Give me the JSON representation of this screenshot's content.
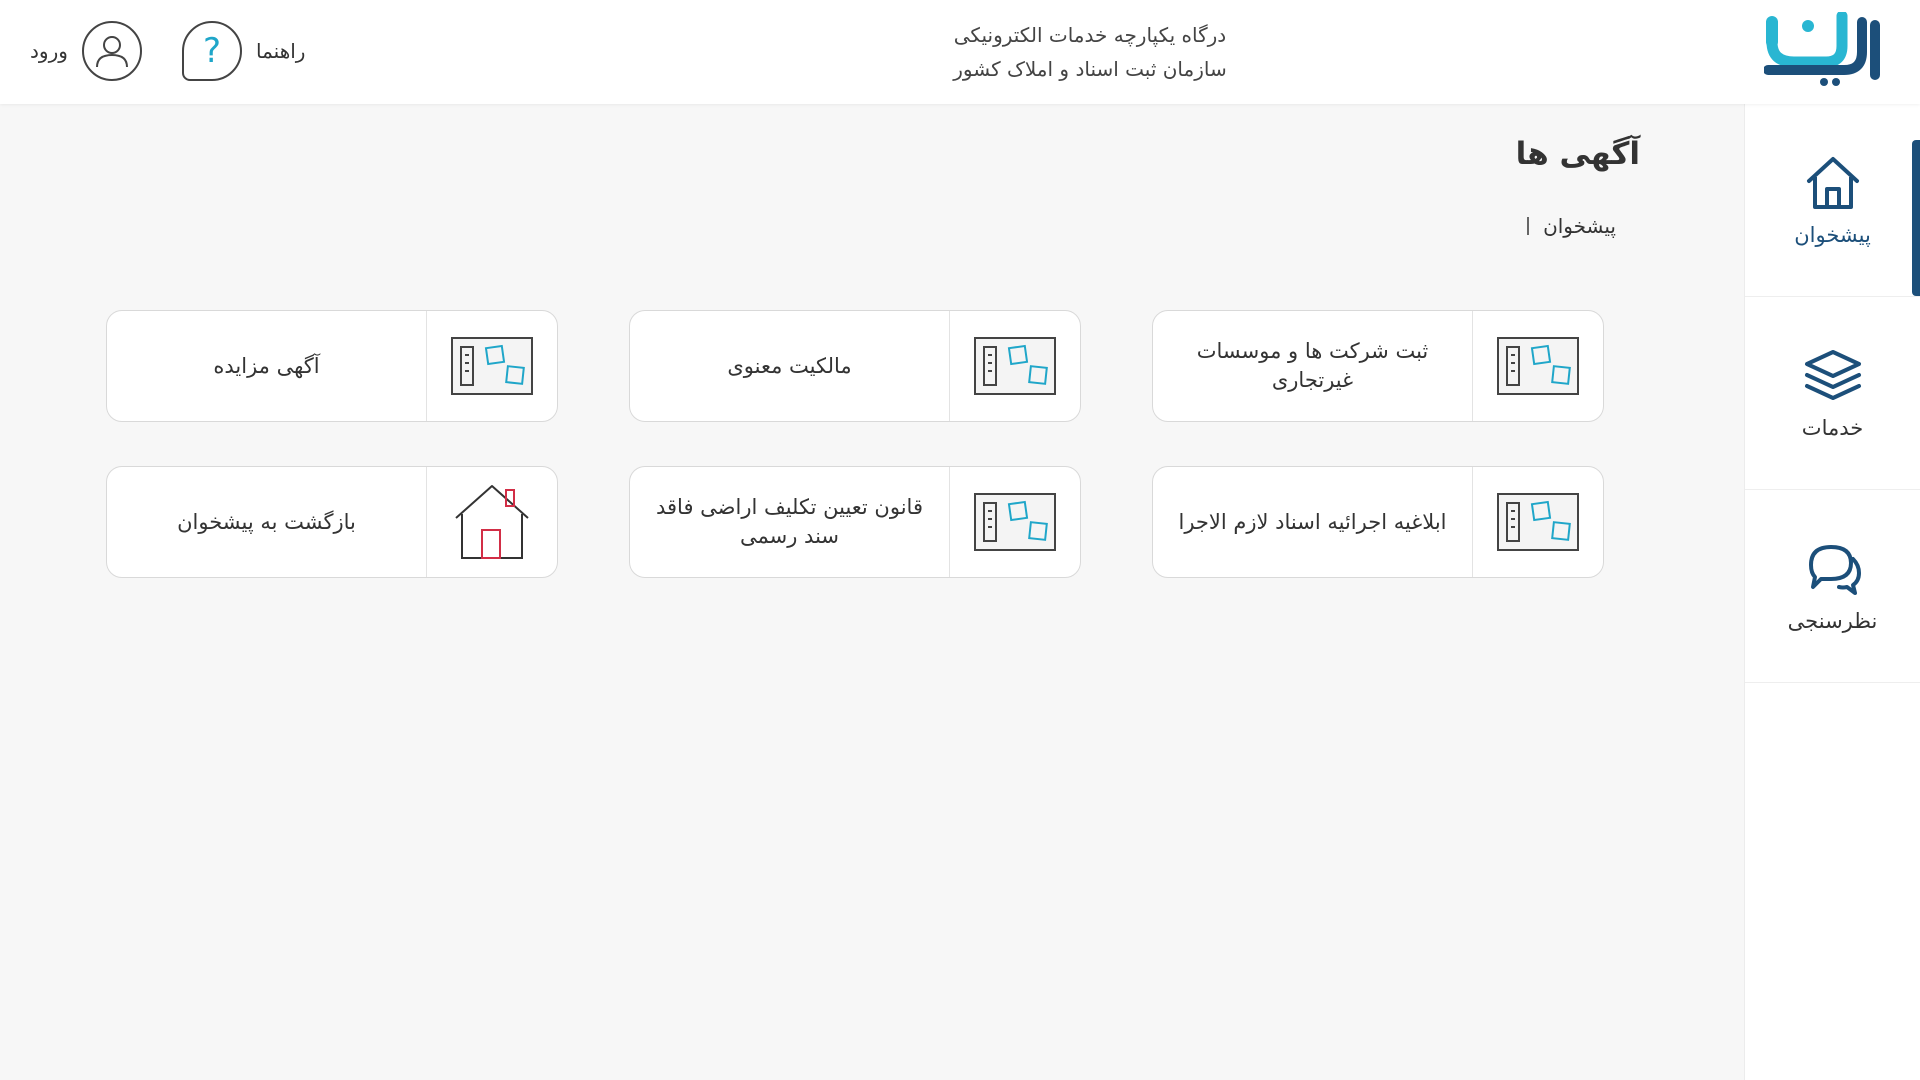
{
  "header": {
    "title_line1": "درگاه یکپارچه خدمات الکترونیکی",
    "title_line2": "سازمان ثبت اسناد و املاک کشور",
    "login_label": "ورود",
    "help_label": "راهنما",
    "help_glyph": "?"
  },
  "logo": {
    "icon": "sabt-man-logo",
    "colors": [
      "#29b6d2",
      "#1c4f7a"
    ]
  },
  "sidebar": {
    "items": [
      {
        "label": "پیشخوان",
        "icon": "home-icon",
        "active": true
      },
      {
        "label": "خدمات",
        "icon": "layers-icon",
        "active": false
      },
      {
        "label": "نظرسنجی",
        "icon": "chat-bubbles-icon",
        "active": false
      }
    ]
  },
  "page": {
    "title": "آگهی ها",
    "breadcrumb": [
      "پیشخوان"
    ]
  },
  "cards": [
    {
      "label": "ثبت شرکت ها و موسسات غیرتجاری",
      "icon": "notice-board-icon"
    },
    {
      "label": "مالکیت معنوی",
      "icon": "notice-board-icon"
    },
    {
      "label": "آگهی مزایده",
      "icon": "notice-board-icon"
    },
    {
      "label": "ابلاغیه اجرائیه اسناد لازم الاجرا",
      "icon": "notice-board-icon"
    },
    {
      "label": "قانون تعیین تکلیف اراضی فاقد سند رسمی",
      "icon": "notice-board-icon"
    },
    {
      "label": "بازگشت به پیشخوان",
      "icon": "house-icon"
    }
  ],
  "colors": {
    "brand_dark": "#1c4f7a",
    "brand_cyan": "#29b6d2",
    "icon_accent": "#1fa6c9",
    "house_accent": "#d22e46"
  }
}
